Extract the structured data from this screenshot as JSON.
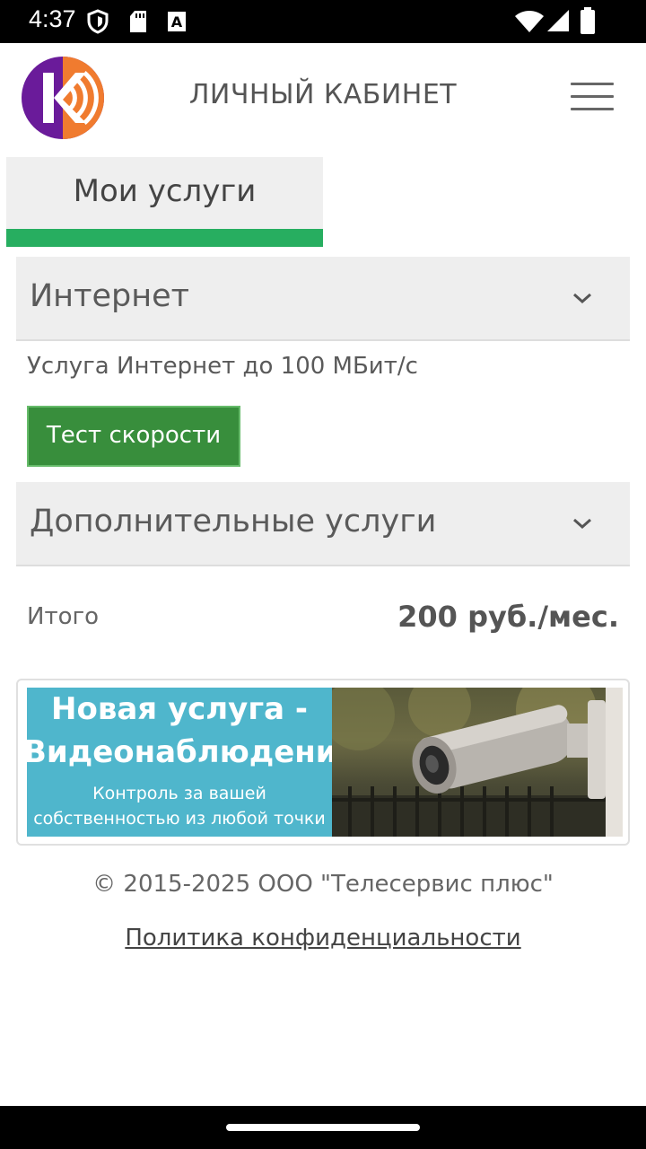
{
  "status_bar": {
    "time": "4:37",
    "icons": [
      "shield-icon",
      "sd-card-icon",
      "font-a-icon",
      "wifi-icon",
      "signal-icon",
      "battery-icon"
    ]
  },
  "header": {
    "title": "ЛИЧНЫЙ КАБИНЕТ",
    "logo_colors": {
      "purple": "#6a1b9a",
      "orange": "#f07b2f"
    }
  },
  "tabs": [
    {
      "label": "Мои услуги",
      "active": true,
      "accent": "#27ae60"
    }
  ],
  "sections": {
    "internet": {
      "title": "Интернет",
      "service_text": "Услуга Интернет до 100 МБит/с",
      "speed_test_label": "Тест скорости"
    },
    "additional": {
      "title": "Дополнительные услуги"
    }
  },
  "total": {
    "label": "Итого",
    "value": "200 руб./мес."
  },
  "banner": {
    "title_line1": "Новая услуга -",
    "title_line2": "Видеонаблюдение",
    "subtitle_line1": "Контроль за вашей",
    "subtitle_line2": "собственностью из любой точки"
  },
  "footer": {
    "copyright": "© 2015-2025 ООО \"Телесервис плюс\"",
    "privacy_link": "Политика конфиденциальности"
  }
}
